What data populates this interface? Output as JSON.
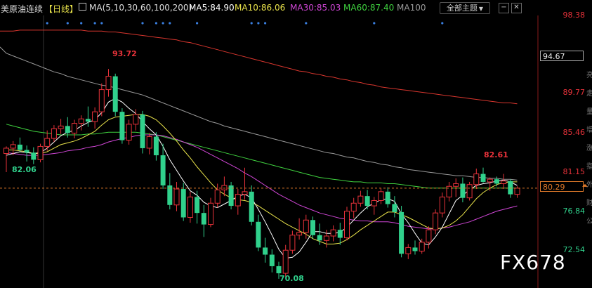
{
  "header": {
    "instrument": "美原油连续",
    "period": "【日线】",
    "ma_params": "MA(5,10,30,60,100,200)",
    "ma5": "MA5:84.90",
    "ma10": "MA10:86.06",
    "ma30": "MA30:85.03",
    "ma60": "MA60:87.40",
    "ma100": "MA100",
    "theme_button": "全部主题",
    "theme_arrow": "▼",
    "colors": {
      "ma5": "#ffffff",
      "ma10": "#e8e24a",
      "ma30": "#d046d6",
      "ma60": "#3fd13f",
      "ma100": "#9a9a9a",
      "ma200": "#d8362e",
      "up": "#e8323a",
      "down": "#30d18c",
      "price_line": "#e07a2a"
    }
  },
  "window_controls": {
    "minus": "−",
    "close": "✕"
  },
  "y_axis": {
    "labels": [
      "98.38",
      "94.67",
      "89.77",
      "85.46",
      "81.15",
      "80.29",
      "76.84",
      "72.54"
    ],
    "boxed_label": "94.67",
    "current_price": "80.29"
  },
  "annotations": {
    "high_left": "93.72",
    "low_left": "82.06",
    "low_mid": "70.08",
    "high_right": "82.61"
  },
  "side_strip": [
    "亮",
    "走",
    "量",
    "增",
    "涨",
    "指",
    "外",
    "财",
    "公"
  ],
  "watermark": "FX678",
  "chart_data": {
    "type": "candlestick",
    "ylim": [
      69.2,
      99.6
    ],
    "candles": [
      [
        84.2,
        85.0,
        82.1,
        84.8
      ],
      [
        84.8,
        85.6,
        84.0,
        85.2
      ],
      [
        85.2,
        86.0,
        84.4,
        84.6
      ],
      [
        84.6,
        85.1,
        83.3,
        84.3
      ],
      [
        84.3,
        84.9,
        83.0,
        83.5
      ],
      [
        83.5,
        85.3,
        83.2,
        85.0
      ],
      [
        85.0,
        86.8,
        84.5,
        85.9
      ],
      [
        85.9,
        87.4,
        85.5,
        87.0
      ],
      [
        87.0,
        88.1,
        86.4,
        87.3
      ],
      [
        87.3,
        88.3,
        86.0,
        86.5
      ],
      [
        86.5,
        88.0,
        85.9,
        87.6
      ],
      [
        87.6,
        88.5,
        86.8,
        88.1
      ],
      [
        88.1,
        89.5,
        87.2,
        87.8
      ],
      [
        87.8,
        89.4,
        87.0,
        88.9
      ],
      [
        88.9,
        92.1,
        88.4,
        91.4
      ],
      [
        91.4,
        93.72,
        90.6,
        92.9
      ],
      [
        92.9,
        93.2,
        88.4,
        88.9
      ],
      [
        88.9,
        89.3,
        85.3,
        85.7
      ],
      [
        85.7,
        88.0,
        85.2,
        87.5
      ],
      [
        87.5,
        89.2,
        86.8,
        88.6
      ],
      [
        88.6,
        89.0,
        84.2,
        84.8
      ],
      [
        84.8,
        86.5,
        84.1,
        86.1
      ],
      [
        86.1,
        86.6,
        83.4,
        84.0
      ],
      [
        84.0,
        85.3,
        80.2,
        80.6
      ],
      [
        80.6,
        82.0,
        77.9,
        78.4
      ],
      [
        78.4,
        81.0,
        77.7,
        80.2
      ],
      [
        80.2,
        80.9,
        76.6,
        77.0
      ],
      [
        77.0,
        79.9,
        76.4,
        79.3
      ],
      [
        79.3,
        80.0,
        76.3,
        77.5
      ],
      [
        77.5,
        78.4,
        74.8,
        76.2
      ],
      [
        76.2,
        79.2,
        75.9,
        78.6
      ],
      [
        78.6,
        80.8,
        78.1,
        80.1
      ],
      [
        80.1,
        81.6,
        79.4,
        80.6
      ],
      [
        80.6,
        81.0,
        77.9,
        78.3
      ],
      [
        78.3,
        80.2,
        77.3,
        79.6
      ],
      [
        79.6,
        82.6,
        79.0,
        79.9
      ],
      [
        79.9,
        80.6,
        76.1,
        76.5
      ],
      [
        76.5,
        77.3,
        73.2,
        73.6
      ],
      [
        73.6,
        74.7,
        71.9,
        72.8
      ],
      [
        72.8,
        73.4,
        70.8,
        71.5
      ],
      [
        71.5,
        72.0,
        70.08,
        70.7
      ],
      [
        70.7,
        73.9,
        70.3,
        73.3
      ],
      [
        73.3,
        75.5,
        72.9,
        75.0
      ],
      [
        75.0,
        76.9,
        74.5,
        75.3
      ],
      [
        75.3,
        77.3,
        74.6,
        76.7
      ],
      [
        76.7,
        77.1,
        74.6,
        75.0
      ],
      [
        75.0,
        76.3,
        73.9,
        74.4
      ],
      [
        74.4,
        75.6,
        73.6,
        74.9
      ],
      [
        74.9,
        76.1,
        74.3,
        75.6
      ],
      [
        75.6,
        76.4,
        73.9,
        74.7
      ],
      [
        74.7,
        78.2,
        74.4,
        77.7
      ],
      [
        77.7,
        79.2,
        76.9,
        78.6
      ],
      [
        78.6,
        80.0,
        78.2,
        79.4
      ],
      [
        79.4,
        80.1,
        77.9,
        78.3
      ],
      [
        78.3,
        79.3,
        77.3,
        78.9
      ],
      [
        78.9,
        80.3,
        78.5,
        79.9
      ],
      [
        79.9,
        80.4,
        78.1,
        78.5
      ],
      [
        78.5,
        79.4,
        77.0,
        77.6
      ],
      [
        77.6,
        78.3,
        72.5,
        72.9
      ],
      [
        72.9,
        74.0,
        72.3,
        73.6
      ],
      [
        73.6,
        74.4,
        72.8,
        73.2
      ],
      [
        73.2,
        74.6,
        72.9,
        74.2
      ],
      [
        74.2,
        76.0,
        73.5,
        75.6
      ],
      [
        75.6,
        77.9,
        75.1,
        77.5
      ],
      [
        77.5,
        79.8,
        77.0,
        79.3
      ],
      [
        79.3,
        81.0,
        78.8,
        80.5
      ],
      [
        80.5,
        81.4,
        79.3,
        80.8
      ],
      [
        80.8,
        81.5,
        78.7,
        79.2
      ],
      [
        79.2,
        81.0,
        78.9,
        80.7
      ],
      [
        80.7,
        82.5,
        80.2,
        81.9
      ],
      [
        81.9,
        82.61,
        80.9,
        81.0
      ],
      [
        81.0,
        81.5,
        80.0,
        81.3
      ],
      [
        81.3,
        81.6,
        80.5,
        80.8
      ],
      [
        80.8,
        81.9,
        80.2,
        81.1
      ],
      [
        81.1,
        81.3,
        79.2,
        79.6
      ],
      [
        79.6,
        80.5,
        79.2,
        80.29
      ]
    ],
    "ma_lines": {
      "ma5": [
        84.0,
        84.2,
        84.4,
        84.3,
        84.2,
        84.3,
        84.8,
        85.5,
        86.2,
        86.6,
        86.8,
        87.3,
        87.7,
        88.0,
        88.8,
        90.0,
        90.4,
        90.0,
        89.3,
        88.7,
        87.8,
        87.0,
        86.3,
        85.0,
        83.5,
        82.3,
        81.1,
        80.0,
        79.5,
        78.7,
        78.3,
        78.1,
        78.5,
        78.9,
        79.4,
        79.6,
        79.2,
        77.9,
        76.5,
        75.0,
        73.4,
        72.4,
        72.5,
        73.1,
        74.2,
        75.4,
        75.4,
        75.2,
        75.2,
        75.3,
        75.9,
        76.7,
        77.5,
        78.2,
        78.6,
        79.0,
        79.1,
        78.8,
        77.4,
        76.4,
        75.2,
        74.1,
        73.9,
        74.8,
        75.9,
        77.4,
        78.9,
        79.5,
        80.1,
        80.6,
        80.8,
        80.9,
        81.1,
        81.2,
        81.0,
        80.6
      ],
      "ma10": [
        84.6,
        84.6,
        84.5,
        84.4,
        84.2,
        84.2,
        84.4,
        84.8,
        85.2,
        85.4,
        85.6,
        85.9,
        86.3,
        86.7,
        87.4,
        88.0,
        88.3,
        88.4,
        88.5,
        88.6,
        88.6,
        88.4,
        88.0,
        87.3,
        86.5,
        85.6,
        84.6,
        83.7,
        82.7,
        81.8,
        80.9,
        80.1,
        79.6,
        79.2,
        79.0,
        78.9,
        78.7,
        78.3,
        77.8,
        77.3,
        76.8,
        76.3,
        75.9,
        75.5,
        75.1,
        74.6,
        74.3,
        74.0,
        74.0,
        74.1,
        74.5,
        75.0,
        75.6,
        76.1,
        76.6,
        77.1,
        77.6,
        77.6,
        77.3,
        77.0,
        76.6,
        76.2,
        75.8,
        75.7,
        75.8,
        76.1,
        76.6,
        77.3,
        78.2,
        79.1,
        79.8,
        80.3,
        80.7,
        80.9,
        81.0,
        81.0
      ],
      "ma30": [
        84.3,
        84.2,
        84.1,
        84.0,
        84.0,
        84.0,
        84.1,
        84.2,
        84.3,
        84.5,
        84.6,
        84.7,
        84.9,
        85.0,
        85.2,
        85.5,
        85.7,
        85.9,
        86.0,
        86.2,
        86.3,
        86.3,
        86.3,
        86.2,
        86.0,
        85.8,
        85.5,
        85.2,
        84.9,
        84.5,
        84.1,
        83.7,
        83.3,
        82.9,
        82.5,
        82.0,
        81.6,
        81.1,
        80.6,
        80.1,
        79.6,
        79.2,
        78.8,
        78.4,
        78.1,
        77.8,
        77.5,
        77.3,
        77.1,
        76.9,
        76.8,
        76.7,
        76.6,
        76.6,
        76.5,
        76.5,
        76.5,
        76.4,
        76.2,
        76.0,
        75.9,
        75.8,
        75.7,
        75.7,
        75.8,
        75.9,
        76.1,
        76.3,
        76.5,
        76.8,
        77.1,
        77.4,
        77.7,
        77.9,
        78.1,
        78.3
      ],
      "ma60": [
        87.5,
        87.3,
        87.1,
        86.9,
        86.7,
        86.6,
        86.5,
        86.4,
        86.3,
        86.3,
        86.3,
        86.3,
        86.4,
        86.4,
        86.5,
        86.6,
        86.6,
        86.6,
        86.6,
        86.6,
        86.5,
        86.4,
        86.3,
        86.1,
        85.9,
        85.7,
        85.5,
        85.3,
        85.1,
        84.9,
        84.7,
        84.5,
        84.3,
        84.1,
        83.9,
        83.7,
        83.5,
        83.3,
        83.1,
        82.9,
        82.7,
        82.5,
        82.3,
        82.1,
        81.9,
        81.7,
        81.5,
        81.4,
        81.3,
        81.2,
        81.1,
        81.0,
        81.0,
        80.9,
        80.9,
        80.9,
        80.8,
        80.8,
        80.7,
        80.6,
        80.5,
        80.4,
        80.3,
        80.3,
        80.3,
        80.3,
        80.3,
        80.3,
        80.3,
        80.3,
        80.3,
        80.3,
        80.3,
        80.3,
        80.3,
        80.3
      ],
      "ma100": [
        95.5,
        95.2,
        94.9,
        94.6,
        94.3,
        94.0,
        93.7,
        93.4,
        93.2,
        92.9,
        92.7,
        92.5,
        92.3,
        92.1,
        91.9,
        91.8,
        91.6,
        91.4,
        91.2,
        91.0,
        90.8,
        90.5,
        90.2,
        89.9,
        89.6,
        89.3,
        89.0,
        88.7,
        88.4,
        88.1,
        87.8,
        87.6,
        87.3,
        87.1,
        86.9,
        86.7,
        86.5,
        86.3,
        86.1,
        85.9,
        85.7,
        85.5,
        85.3,
        85.1,
        84.9,
        84.7,
        84.5,
        84.3,
        84.2,
        84.0,
        83.8,
        83.7,
        83.5,
        83.3,
        83.2,
        83.0,
        82.9,
        82.7,
        82.6,
        82.4,
        82.3,
        82.2,
        82.1,
        82.0,
        81.9,
        81.8,
        81.7,
        81.7,
        81.6,
        81.5,
        81.5,
        81.4,
        81.4,
        81.3,
        81.3,
        81.2
      ],
      "ma200": [
        98.0,
        98.0,
        98.1,
        98.1,
        98.1,
        98.1,
        98.1,
        98.1,
        98.1,
        98.1,
        98.1,
        98.1,
        98.0,
        98.0,
        98.0,
        97.9,
        97.9,
        97.8,
        97.7,
        97.6,
        97.5,
        97.4,
        97.3,
        97.2,
        97.1,
        97.0,
        96.8,
        96.7,
        96.5,
        96.3,
        96.1,
        95.9,
        95.7,
        95.5,
        95.3,
        95.1,
        94.9,
        94.7,
        94.5,
        94.3,
        94.1,
        93.9,
        93.7,
        93.5,
        93.4,
        93.2,
        93.1,
        92.9,
        92.8,
        92.6,
        92.5,
        92.3,
        92.2,
        92.0,
        91.9,
        91.7,
        91.6,
        91.5,
        91.4,
        91.3,
        91.2,
        91.1,
        91.0,
        90.9,
        90.8,
        90.7,
        90.6,
        90.5,
        90.4,
        90.3,
        90.2,
        90.1,
        90.0,
        89.9,
        89.9,
        89.8
      ]
    },
    "event_markers": [
      6,
      9,
      11,
      13,
      14,
      20,
      22,
      23,
      24,
      28,
      36,
      37,
      38,
      44,
      54,
      64
    ],
    "current_price": 80.29
  }
}
